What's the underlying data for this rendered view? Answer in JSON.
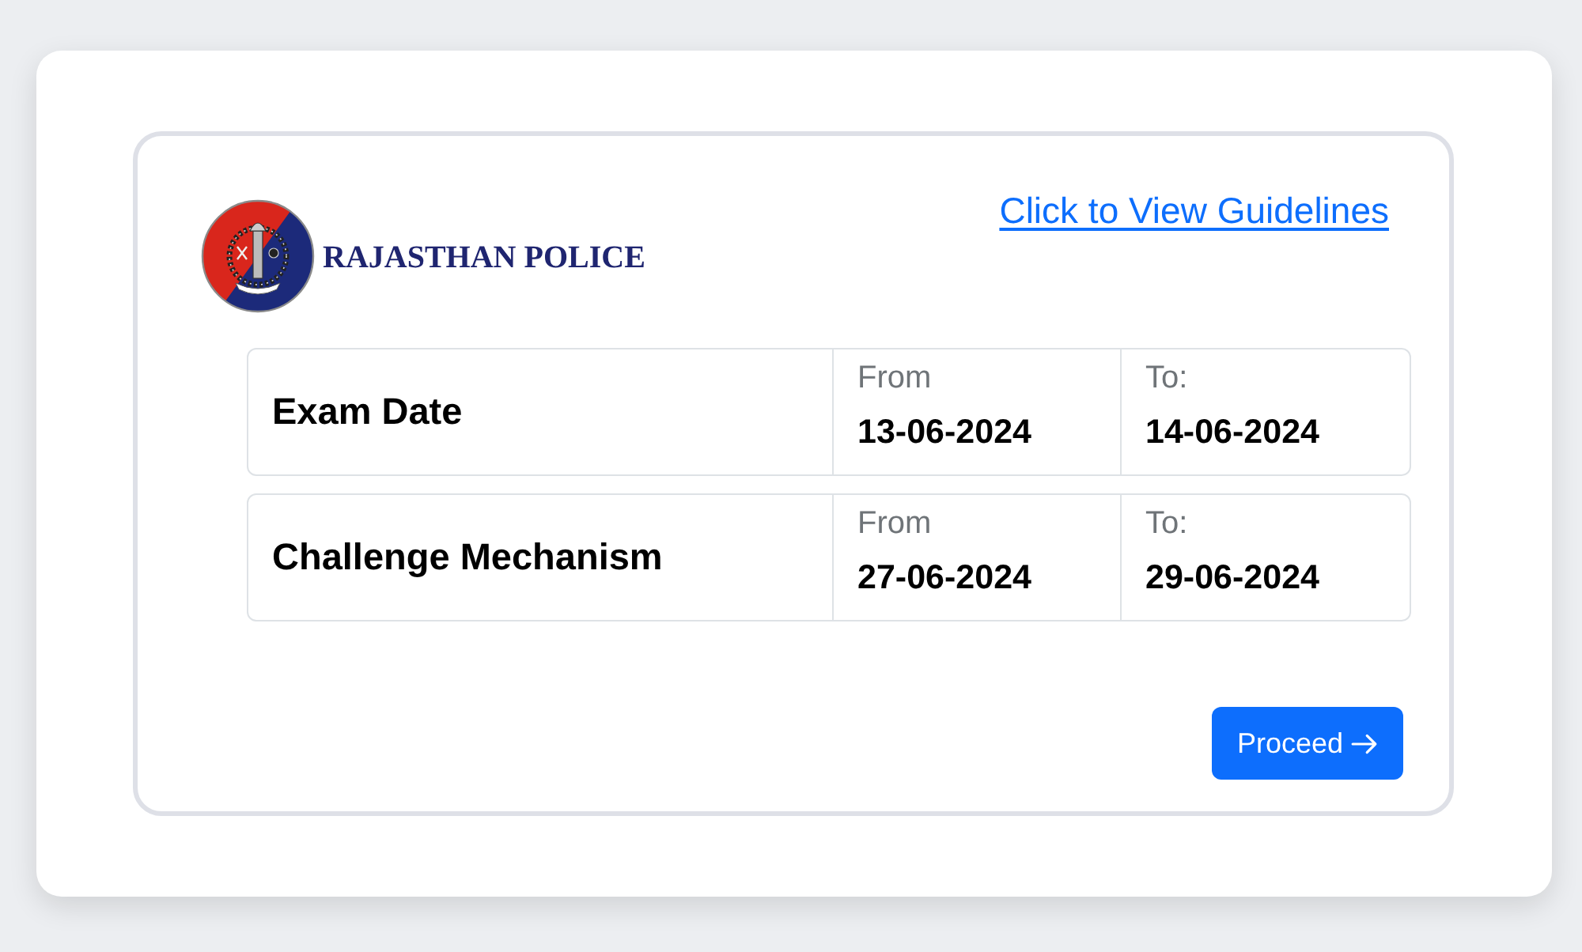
{
  "logo": {
    "title": "RAJASTHAN POLICE"
  },
  "guidelines_link": {
    "label": "Click to View Guidelines"
  },
  "schedule": [
    {
      "label": "Exam Date",
      "from_label": "From",
      "from": "13-06-2024",
      "to_label": "To:",
      "to": "14-06-2024"
    },
    {
      "label": "Challenge Mechanism",
      "from_label": "From",
      "from": "27-06-2024",
      "to_label": "To:",
      "to": "29-06-2024"
    }
  ],
  "buttons": [
    {
      "label": "Proceed"
    }
  ]
}
